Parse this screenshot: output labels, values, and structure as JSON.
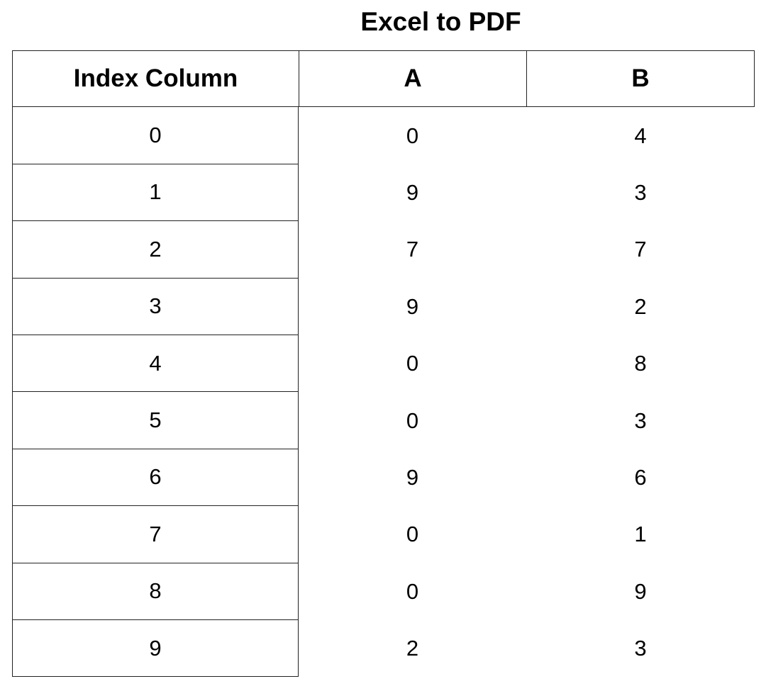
{
  "title": "Excel to PDF",
  "table": {
    "headers": [
      "Index Column",
      "A",
      "B"
    ],
    "rows": [
      [
        "0",
        "0",
        "4"
      ],
      [
        "1",
        "9",
        "3"
      ],
      [
        "2",
        "7",
        "7"
      ],
      [
        "3",
        "9",
        "2"
      ],
      [
        "4",
        "0",
        "8"
      ],
      [
        "5",
        "0",
        "3"
      ],
      [
        "6",
        "9",
        "6"
      ],
      [
        "7",
        "0",
        "1"
      ],
      [
        "8",
        "0",
        "9"
      ],
      [
        "9",
        "2",
        "3"
      ]
    ]
  }
}
